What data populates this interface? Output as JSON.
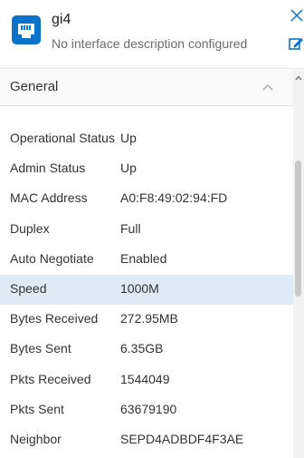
{
  "header": {
    "icon": "ethernet-port-icon",
    "title": "gi4",
    "subtitle": "No interface description configured",
    "accent_color": "#0a73c9"
  },
  "section": {
    "label": "General",
    "state": "expanded"
  },
  "rows": [
    {
      "label": "Operational Status",
      "value": "Up"
    },
    {
      "label": "Admin Status",
      "value": "Up"
    },
    {
      "label": "MAC Address",
      "value": "A0:F8:49:02:94:FD"
    },
    {
      "label": "Duplex",
      "value": "Full"
    },
    {
      "label": "Auto Negotiate",
      "value": "Enabled"
    },
    {
      "label": "Speed",
      "value": "1000M"
    },
    {
      "label": "Bytes Received",
      "value": "272.95MB"
    },
    {
      "label": "Bytes Sent",
      "value": "6.35GB"
    },
    {
      "label": "Pkts Received",
      "value": "1544049"
    },
    {
      "label": "Pkts Sent",
      "value": "63679190"
    },
    {
      "label": "Neighbor",
      "value": "SEPD4ADBDF4F3AE"
    }
  ],
  "highlight_color": "#deebf6"
}
